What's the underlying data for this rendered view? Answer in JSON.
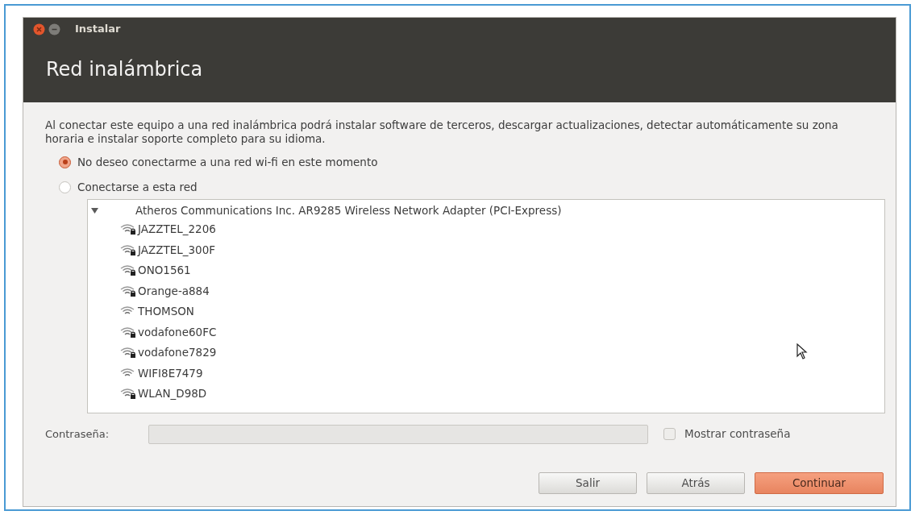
{
  "window": {
    "title": "Instalar",
    "heading": "Red inalámbrica"
  },
  "description": "Al conectar este equipo a una red inalámbrica podrá instalar software de terceros, descargar actualizaciones, detectar automáticamente su zona horaria e instalar soporte completo para su idioma.",
  "options": [
    {
      "label": "No deseo conectarme a una red wi-fi en este momento",
      "selected": true
    },
    {
      "label": "Conectarse a esta red",
      "selected": false
    }
  ],
  "network_tree": {
    "adapter": "Atheros Communications Inc. AR9285 Wireless Network Adapter (PCI-Express)",
    "expanded": true,
    "children": [
      {
        "name": "JAZZTEL_2206",
        "secured": true
      },
      {
        "name": "JAZZTEL_300F",
        "secured": true
      },
      {
        "name": "ONO1561",
        "secured": true
      },
      {
        "name": "Orange-a884",
        "secured": true
      },
      {
        "name": "THOMSON",
        "secured": false
      },
      {
        "name": "vodafone60FC",
        "secured": true
      },
      {
        "name": "vodafone7829",
        "secured": true
      },
      {
        "name": "WIFI8E7479",
        "secured": false
      },
      {
        "name": "WLAN_D98D",
        "secured": true
      }
    ]
  },
  "password": {
    "label": "Contraseña:",
    "show_password": {
      "label": "Mostrar contraseña",
      "checked": false
    }
  },
  "buttons": [
    {
      "label": "Salir",
      "kind": "normal"
    },
    {
      "label": "Atrás",
      "kind": "normal"
    },
    {
      "label": "Continuar",
      "kind": "primary"
    }
  ]
}
